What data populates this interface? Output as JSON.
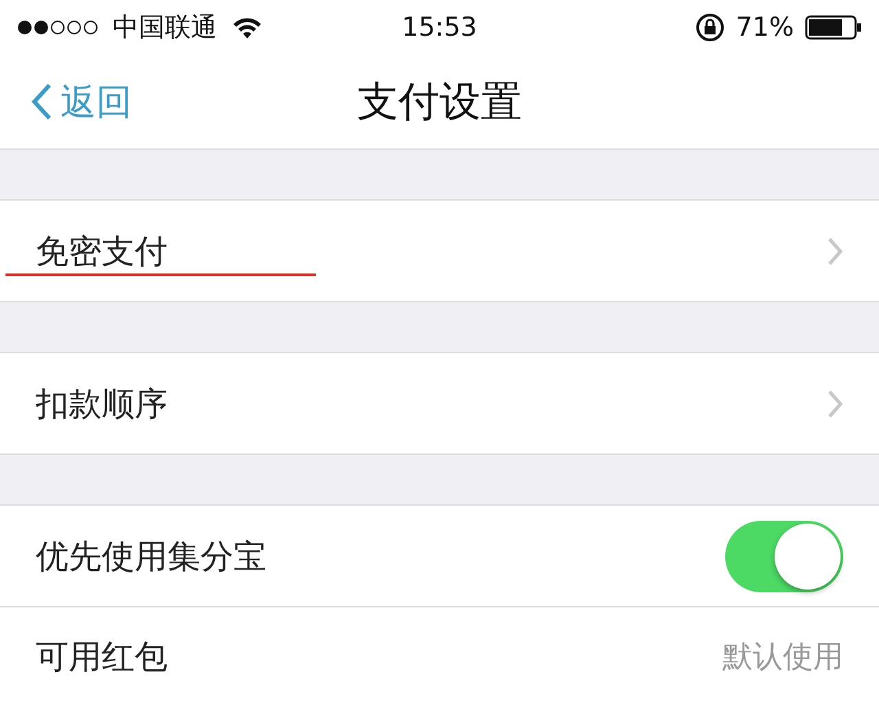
{
  "status_bar": {
    "carrier": "中国联通",
    "time": "15:53",
    "battery": "71%"
  },
  "nav_bar": {
    "back": "返回",
    "title": "支付设置"
  },
  "sections": [
    {
      "rows": [
        {
          "kind": "link",
          "label": "免密支付",
          "underlined": true
        }
      ]
    },
    {
      "rows": [
        {
          "kind": "link",
          "label": "扣款顺序",
          "underlined": false
        }
      ]
    },
    {
      "rows": [
        {
          "kind": "toggle",
          "label": "优先使用集分宝",
          "on": true
        },
        {
          "kind": "value",
          "label": "可用红包",
          "value": "默认使用"
        }
      ]
    }
  ]
}
